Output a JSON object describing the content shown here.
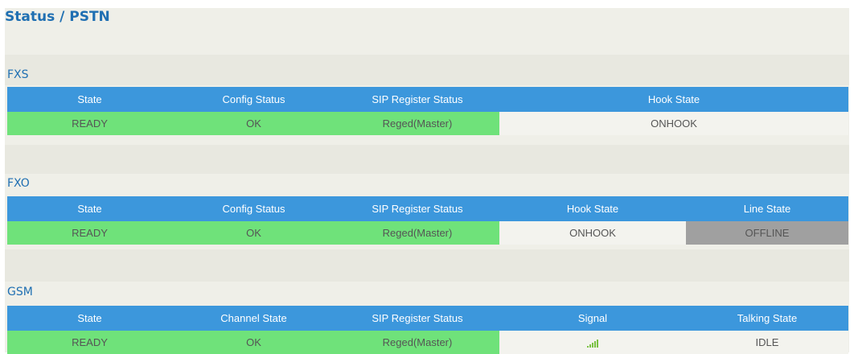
{
  "page": {
    "title": "Status / PSTN"
  },
  "fxs": {
    "title": "FXS",
    "headers": [
      "State",
      "Config Status",
      "SIP Register Status",
      "Hook State"
    ],
    "row": [
      "READY",
      "OK",
      "Reged(Master)",
      "ONHOOK"
    ]
  },
  "fxo": {
    "title": "FXO",
    "headers": [
      "State",
      "Config Status",
      "SIP Register Status",
      "Hook State",
      "Line State"
    ],
    "row": [
      "READY",
      "OK",
      "Reged(Master)",
      "ONHOOK",
      "OFFLINE"
    ]
  },
  "gsm": {
    "title": "GSM",
    "headers": [
      "State",
      "Channel State",
      "SIP Register Status",
      "Signal",
      "Talking State"
    ],
    "row": [
      "READY",
      "OK",
      "Reged(Master)",
      "",
      "IDLE"
    ],
    "signal_icon": "signal-strength-icon",
    "signal_level": 4
  },
  "colors": {
    "header": "#3c97dc",
    "ready": "#6fe27a",
    "offline": "#a0a0a0",
    "title": "#1f6fb2"
  }
}
